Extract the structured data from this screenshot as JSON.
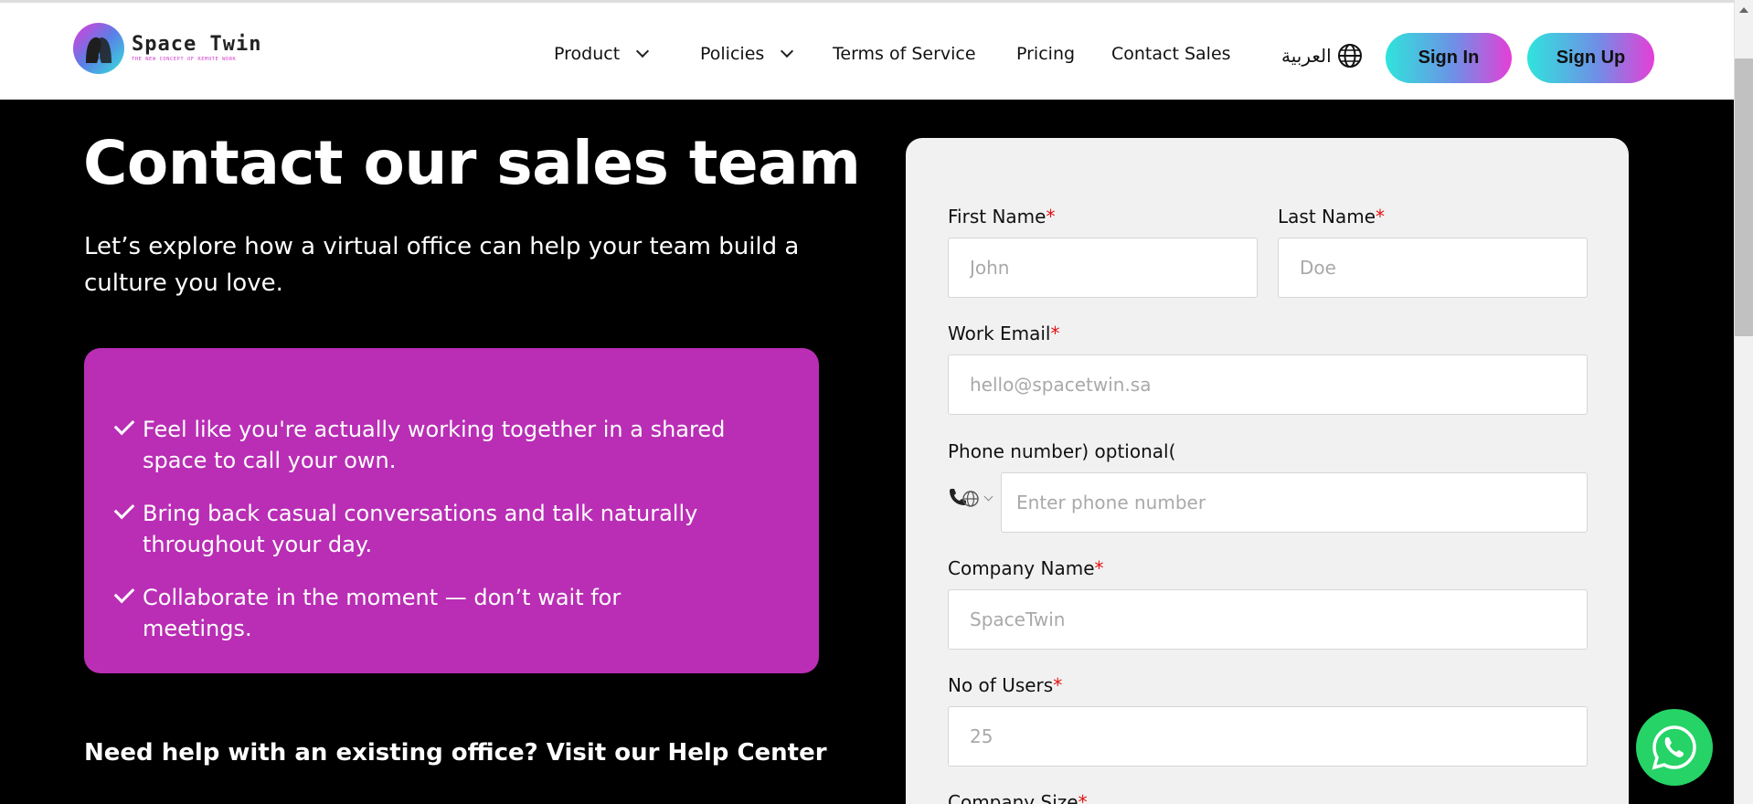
{
  "brand": {
    "name": "Space Twin",
    "tagline": "THE NEW CONCEPT OF REMOTE WORK"
  },
  "nav": {
    "product": "Product",
    "policies": "Policies",
    "terms": "Terms of Service",
    "pricing": "Pricing",
    "contact": "Contact Sales",
    "language": "العربية",
    "sign_in": "Sign In",
    "sign_up": "Sign Up"
  },
  "hero": {
    "title": "Contact our sales team",
    "subtitle": "Let’s explore how a virtual office can help your team build a culture you love."
  },
  "features": [
    "Feel like you're actually working together in a shared space to call your own.",
    "Bring back casual conversations and talk naturally throughout your day.",
    "Collaborate in the moment — don’t wait for meetings."
  ],
  "help_line": "Need help with an existing office? Visit our Help Center",
  "form": {
    "first_name_label": "First Name",
    "first_name_placeholder": "John",
    "last_name_label": "Last Name",
    "last_name_placeholder": "Doe",
    "email_label": "Work Email",
    "email_placeholder": "hello@spacetwin.sa",
    "phone_label": "Phone number) optional(",
    "phone_placeholder": "Enter phone number",
    "company_label": "Company Name",
    "company_placeholder": "SpaceTwin",
    "users_label": "No of Users",
    "users_placeholder": "25",
    "company_size_label": "Company Size",
    "required_mark": "*"
  },
  "colors": {
    "accent_purple": "#b92eb5",
    "gradient_cyan": "#2fe4dc",
    "gradient_pink": "#e53fd6",
    "required_red": "#e31212",
    "whatsapp_green": "#25d366"
  },
  "icons": [
    "chevron-down-icon",
    "globe-icon",
    "check-icon",
    "phone-icon",
    "whatsapp-icon"
  ]
}
